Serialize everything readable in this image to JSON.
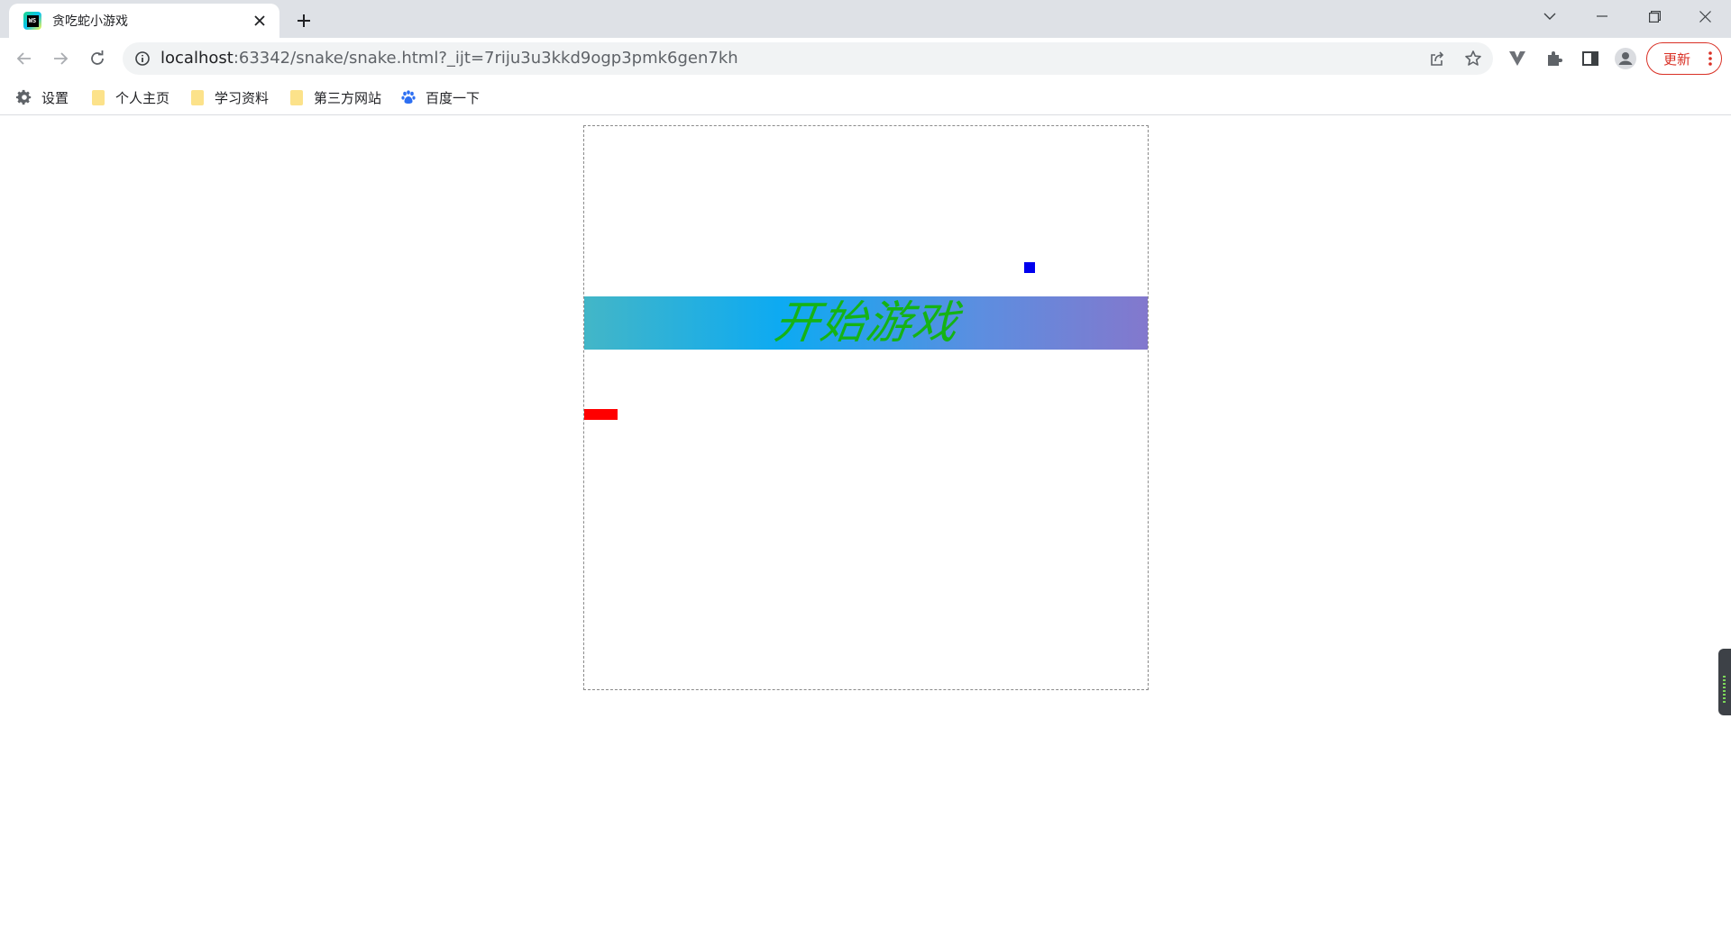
{
  "browser": {
    "tab": {
      "title": "贪吃蛇小游戏",
      "favicon": "webstorm-icon"
    },
    "url": {
      "host": "localhost",
      "path": ":63342/snake/snake.html?_ijt=7riju3u3kkd9ogp3pmk6gen7kh"
    },
    "update_label": "更新",
    "bookmarks": [
      {
        "label": "设置",
        "icon": "gear-icon"
      },
      {
        "label": "个人主页",
        "icon": "folder-icon"
      },
      {
        "label": "学习资料",
        "icon": "folder-icon"
      },
      {
        "label": "第三方网站",
        "icon": "folder-icon"
      },
      {
        "label": "百度一下",
        "icon": "baidu-paw-icon"
      }
    ]
  },
  "game": {
    "start_label": "开始游戏",
    "colors": {
      "snake": "#ff0000",
      "food": "#0000ee",
      "start_text": "#15b315",
      "banner_gradient": [
        "#43b6c7",
        "#0daaf2",
        "#8378cd"
      ]
    }
  }
}
